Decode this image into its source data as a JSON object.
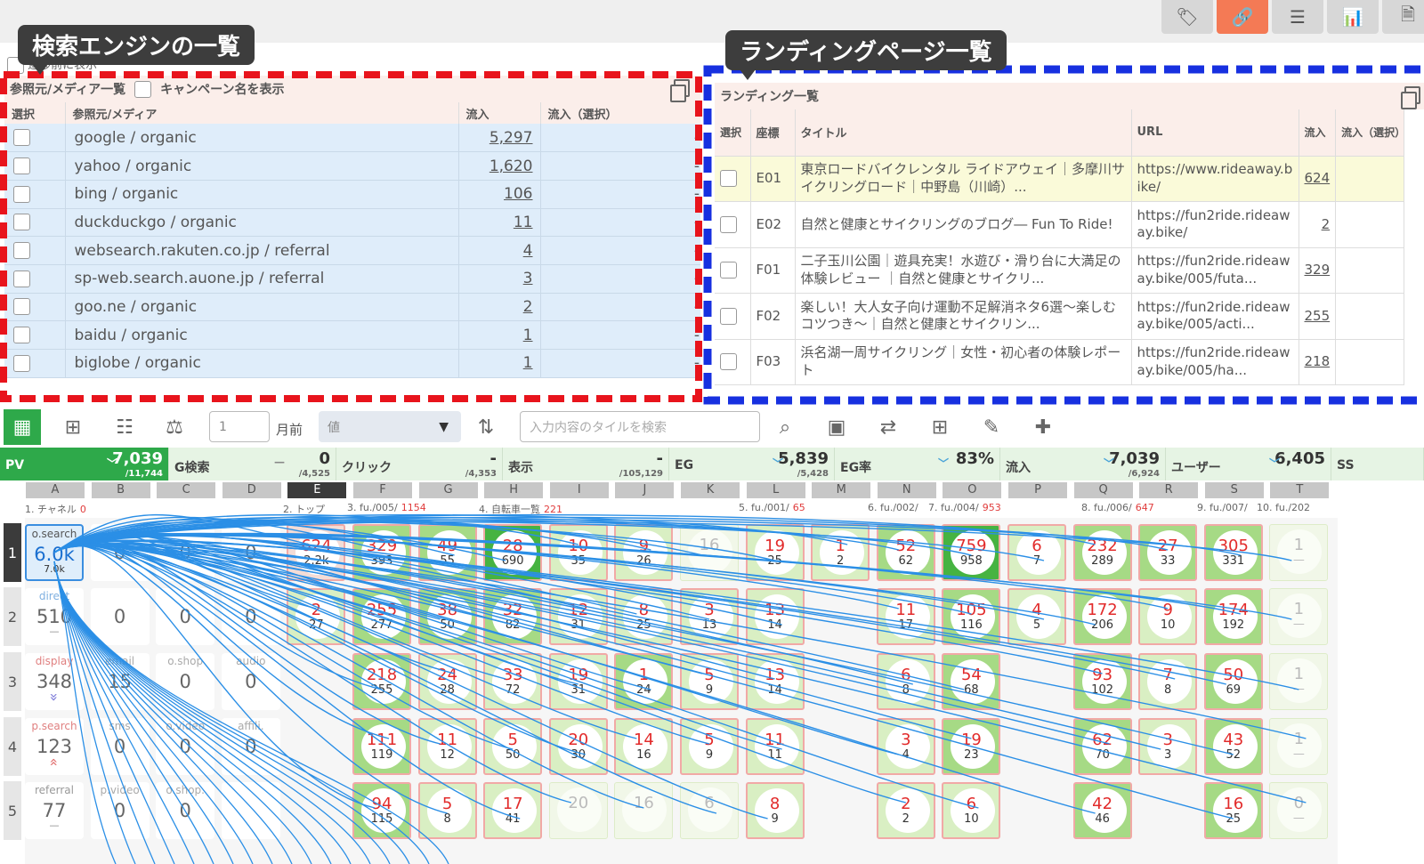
{
  "top_buttons": [
    "tag-icon",
    "link-icon",
    "list-icon",
    "chart-icon",
    "report-icon"
  ],
  "callouts": {
    "left": "検索エンジンの一覧",
    "right": "ランディングページ一覧"
  },
  "hidden_row_text": "遷移前に表示",
  "referrer_panel": {
    "title": "参照元/メディア一覧",
    "campaign_label": "キャンペーン名を表示",
    "headers": [
      "選択",
      "参照元/メディア",
      "流入",
      "流入（選択）"
    ],
    "rows": [
      [
        "google / organic",
        "5,297",
        "-"
      ],
      [
        "yahoo / organic",
        "1,620",
        "-"
      ],
      [
        "bing / organic",
        "106",
        "-"
      ],
      [
        "duckduckgo / organic",
        "11",
        "-"
      ],
      [
        "websearch.rakuten.co.jp / referral",
        "4",
        "-"
      ],
      [
        "sp-web.search.auone.jp / referral",
        "3",
        "-"
      ],
      [
        "goo.ne / organic",
        "2",
        "-"
      ],
      [
        "baidu / organic",
        "1",
        "-"
      ],
      [
        "biglobe / organic",
        "1",
        "-"
      ]
    ]
  },
  "landing_panel": {
    "title": "ランディング一覧",
    "headers": [
      "選択",
      "座標",
      "タイトル",
      "URL",
      "流入",
      "流入（選択）"
    ],
    "rows": [
      [
        "E01",
        "東京ロードバイクレンタル ライドアウェイ｜多摩川サイクリングロード｜中野島（川崎）...",
        "https://www.rideaway.bike/",
        "624"
      ],
      [
        "E02",
        "自然と健康とサイクリングのブログ― Fun To Ride!",
        "https://fun2ride.rideaway.bike/",
        "2"
      ],
      [
        "F01",
        "二子玉川公園｜遊具充実！水遊び・滑り台に大満足の体験レビュー ｜自然と健康とサイクリ...",
        "https://fun2ride.rideaway.bike/005/futa...",
        "329"
      ],
      [
        "F02",
        "楽しい！大人女子向け運動不足解消ネタ6選〜楽しむコツつき〜｜自然と健康とサイクリン...",
        "https://fun2ride.rideaway.bike/005/acti...",
        "255"
      ],
      [
        "F03",
        "浜名湖一周サイクリング｜女性・初心者の体験レポート",
        "https://fun2ride.rideaway.bike/005/ha...",
        "218"
      ]
    ]
  },
  "toolbar": {
    "month_value": "1",
    "month_label": "月前",
    "select_value": "値",
    "search_placeholder": "入力内容のタイルを検索"
  },
  "metrics": [
    {
      "label": "PV",
      "value": "7,039",
      "sub": "/11,744",
      "caret": true
    },
    {
      "label": "G検索",
      "value": "0",
      "sub": "/4,525",
      "caret": false
    },
    {
      "label": "クリック",
      "value": "-",
      "sub": "/4,353",
      "caret": false
    },
    {
      "label": "表示",
      "value": "-",
      "sub": "/105,129",
      "caret": false
    },
    {
      "label": "EG",
      "value": "5,839",
      "sub": "/5,428",
      "caret": true
    },
    {
      "label": "EG率",
      "value": "83%",
      "sub": "",
      "caret": true
    },
    {
      "label": "流入",
      "value": "7,039",
      "sub": "/6,924",
      "caret": true
    },
    {
      "label": "ユーザー",
      "value": "6,405",
      "sub": "",
      "caret": true
    },
    {
      "label": "SS",
      "value": "",
      "sub": "",
      "caret": false
    }
  ],
  "columns": [
    "A",
    "B",
    "C",
    "D",
    "E",
    "F",
    "G",
    "H",
    "I",
    "J",
    "K",
    "L",
    "M",
    "N",
    "O",
    "P",
    "Q",
    "R",
    "S",
    "T"
  ],
  "channel_labels": [
    {
      "text": "1. チャネル",
      "num": "0"
    },
    {
      "text": "2. トップ",
      "num": ""
    },
    {
      "text": "3. fu./005/",
      "num": "1154"
    },
    {
      "text": "4. 自転車一覧",
      "num": "221"
    },
    {
      "text": "5. fu./001/",
      "num": "65"
    },
    {
      "text": "6. fu./002/",
      "num": ""
    },
    {
      "text": "7. fu./004/",
      "num": "953"
    },
    {
      "text": "8. fu./006/",
      "num": "647"
    },
    {
      "text": "9. fu./007/",
      "num": ""
    },
    {
      "text": "10. fu./202",
      "num": ""
    }
  ],
  "rows": [
    "1",
    "2",
    "3",
    "4",
    "5"
  ],
  "left_cells": [
    [
      {
        "n": "o.search",
        "b": "6.0k",
        "s": "7.0k"
      },
      {
        "n": "unas",
        "b": "0",
        "s": ""
      },
      {
        "n": "",
        "b": "0",
        "s": ""
      },
      {
        "n": "",
        "b": "0",
        "s": ""
      }
    ],
    [
      {
        "n": "direct",
        "b": "510",
        "s": "—"
      },
      {
        "n": "",
        "b": "0",
        "s": ""
      },
      {
        "n": "",
        "b": "0",
        "s": ""
      },
      {
        "n": "",
        "b": "0",
        "s": ""
      }
    ],
    [
      {
        "n": "display",
        "b": "348",
        "s": "»"
      },
      {
        "n": "email",
        "b": "15",
        "s": ""
      },
      {
        "n": "o.shop",
        "b": "0",
        "s": ""
      },
      {
        "n": "audio",
        "b": "0",
        "s": ""
      }
    ],
    [
      {
        "n": "p.search",
        "b": "123",
        "s": "«"
      },
      {
        "n": "sms",
        "b": "0",
        "s": ""
      },
      {
        "n": "o.video",
        "b": "0",
        "s": ""
      },
      {
        "n": "affili.",
        "b": "0",
        "s": ""
      }
    ],
    [
      {
        "n": "referral",
        "b": "77",
        "s": "—"
      },
      {
        "n": "p.video",
        "b": "0",
        "s": ""
      },
      {
        "n": "o.shop.",
        "b": "0",
        "s": ""
      },
      {
        "n": "",
        "b": "",
        "s": ""
      }
    ]
  ],
  "data_cells": [
    [
      [
        "624",
        "2.2k",
        "b4"
      ],
      [
        "329",
        "393",
        "b2"
      ],
      [
        "49",
        "55",
        "b2"
      ],
      [
        "28",
        "690",
        "b3"
      ],
      [
        "10",
        "35",
        "b1"
      ],
      [
        "9",
        "26",
        "b1"
      ],
      [
        "16",
        "",
        "b0"
      ],
      [
        "19",
        "25",
        "b1"
      ],
      [
        "1",
        "2",
        "b1"
      ],
      [
        "52",
        "62",
        "b2"
      ],
      [
        "759",
        "958",
        "b3"
      ],
      [
        "6",
        "7",
        "b1"
      ],
      [
        "232",
        "289",
        "b2"
      ],
      [
        "27",
        "33",
        "b2"
      ],
      [
        "305",
        "331",
        "b2"
      ],
      [
        "1",
        "—",
        "b0"
      ]
    ],
    [
      [
        "2",
        "27",
        "b1"
      ],
      [
        "255",
        "277",
        "b2"
      ],
      [
        "38",
        "50",
        "b2"
      ],
      [
        "32",
        "82",
        "b2"
      ],
      [
        "12",
        "31",
        "b1"
      ],
      [
        "8",
        "25",
        "b1"
      ],
      [
        "3",
        "13",
        "b1"
      ],
      [
        "13",
        "14",
        "b1"
      ],
      [
        "",
        "",
        ""
      ],
      [
        "11",
        "17",
        "b1"
      ],
      [
        "105",
        "116",
        "b2"
      ],
      [
        "4",
        "5",
        "b1"
      ],
      [
        "172",
        "206",
        "b2"
      ],
      [
        "9",
        "10",
        "b1"
      ],
      [
        "174",
        "192",
        "b2"
      ],
      [
        "1",
        "—",
        "b0"
      ]
    ],
    [
      [
        "",
        "",
        ""
      ],
      [
        "218",
        "255",
        "b2"
      ],
      [
        "24",
        "28",
        "b1"
      ],
      [
        "33",
        "72",
        "b1"
      ],
      [
        "19",
        "31",
        "b1"
      ],
      [
        "1",
        "24",
        "b2"
      ],
      [
        "5",
        "9",
        "b1"
      ],
      [
        "13",
        "14",
        "b1"
      ],
      [
        "",
        "",
        ""
      ],
      [
        "6",
        "8",
        "b1"
      ],
      [
        "54",
        "68",
        "b2"
      ],
      [
        "",
        "",
        ""
      ],
      [
        "93",
        "102",
        "b2"
      ],
      [
        "7",
        "8",
        "b1"
      ],
      [
        "50",
        "69",
        "b2"
      ],
      [
        "1",
        "—",
        "b0"
      ]
    ],
    [
      [
        "",
        "",
        ""
      ],
      [
        "111",
        "119",
        "b2"
      ],
      [
        "11",
        "12",
        "b1"
      ],
      [
        "5",
        "50",
        "b1"
      ],
      [
        "20",
        "30",
        "b1"
      ],
      [
        "14",
        "16",
        "b1"
      ],
      [
        "5",
        "9",
        "b1"
      ],
      [
        "11",
        "11",
        "b1"
      ],
      [
        "",
        "",
        ""
      ],
      [
        "3",
        "4",
        "b1"
      ],
      [
        "19",
        "23",
        "b2"
      ],
      [
        "",
        "",
        ""
      ],
      [
        "62",
        "70",
        "b2"
      ],
      [
        "3",
        "3",
        "b1"
      ],
      [
        "43",
        "52",
        "b2"
      ],
      [
        "1",
        "—",
        "b0"
      ]
    ],
    [
      [
        "",
        "",
        ""
      ],
      [
        "94",
        "115",
        "b2"
      ],
      [
        "5",
        "8",
        "b1"
      ],
      [
        "17",
        "41",
        "b1"
      ],
      [
        "20",
        "",
        "b0"
      ],
      [
        "16",
        "",
        "b0"
      ],
      [
        "6",
        "",
        "b0"
      ],
      [
        "8",
        "9",
        "b1"
      ],
      [
        "",
        "",
        ""
      ],
      [
        "2",
        "2",
        "b1"
      ],
      [
        "6",
        "10",
        "b1"
      ],
      [
        "",
        "",
        ""
      ],
      [
        "42",
        "46",
        "b2"
      ],
      [
        "",
        "",
        ""
      ],
      [
        "16",
        "25",
        "b2"
      ],
      [
        "0",
        "—",
        "b0"
      ]
    ]
  ]
}
